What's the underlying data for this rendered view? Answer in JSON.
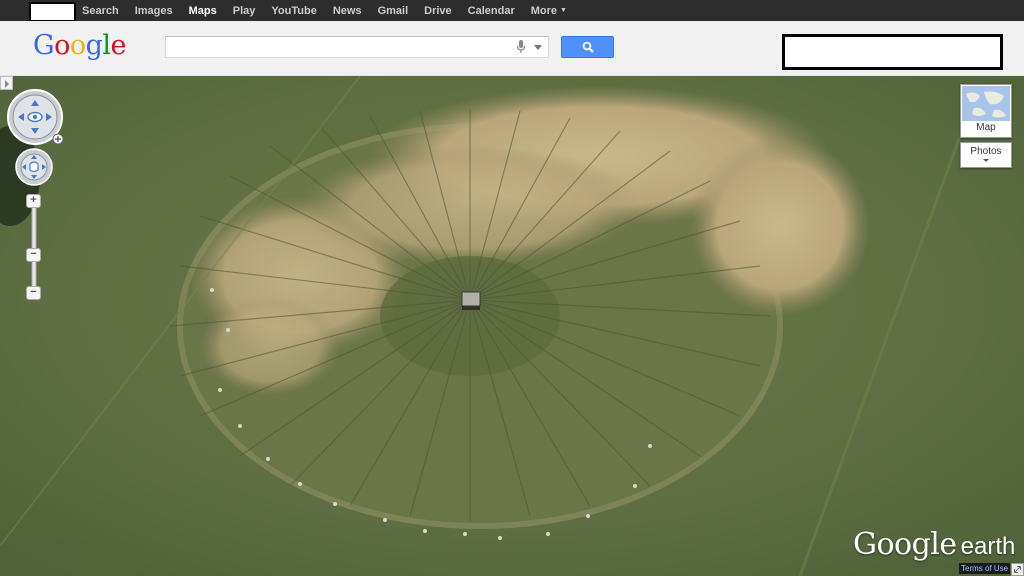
{
  "topbar": {
    "items": [
      "Search",
      "Images",
      "Maps",
      "Play",
      "YouTube",
      "News",
      "Gmail",
      "Drive",
      "Calendar",
      "More"
    ],
    "active": "Maps"
  },
  "header": {
    "logo_letters": [
      "G",
      "o",
      "o",
      "g",
      "l",
      "e"
    ],
    "logo_colors": [
      "#3369e8",
      "#d50f25",
      "#eeb211",
      "#3369e8",
      "#009925",
      "#d50f25"
    ],
    "search_value": "",
    "accent": "#4d90fe"
  },
  "map": {
    "map_type_label": "Map",
    "photos_label": "Photos",
    "earth_brand": "Google",
    "earth_suffix": "earth",
    "terms_label": "Terms of Use",
    "zoom_level": 0.45
  }
}
